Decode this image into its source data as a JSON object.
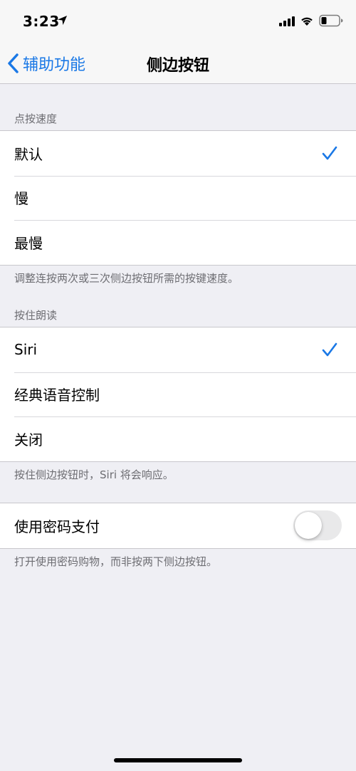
{
  "status_bar": {
    "time": "3:23",
    "icons": [
      "location-arrow-icon",
      "cellular-signal-icon",
      "wifi-icon",
      "battery-icon"
    ]
  },
  "nav": {
    "back_label": "辅助功能",
    "title": "侧边按钮",
    "accent_color": "#1a78e6"
  },
  "click_speed": {
    "header": "点按速度",
    "options": [
      {
        "label": "默认",
        "selected": true
      },
      {
        "label": "慢",
        "selected": false
      },
      {
        "label": "最慢",
        "selected": false
      }
    ],
    "footer": "调整连按两次或三次侧边按钮所需的按键速度。"
  },
  "press_and_hold": {
    "header": "按住朗读",
    "options": [
      {
        "label": "Siri",
        "selected": true
      },
      {
        "label": "经典语音控制",
        "selected": false
      },
      {
        "label": "关闭",
        "selected": false
      }
    ],
    "footer": "按住侧边按钮时，Siri 将会响应。"
  },
  "passcode_payment": {
    "label": "使用密码支付",
    "enabled": false,
    "footer": "打开使用密码购物，而非按两下侧边按钮。"
  }
}
